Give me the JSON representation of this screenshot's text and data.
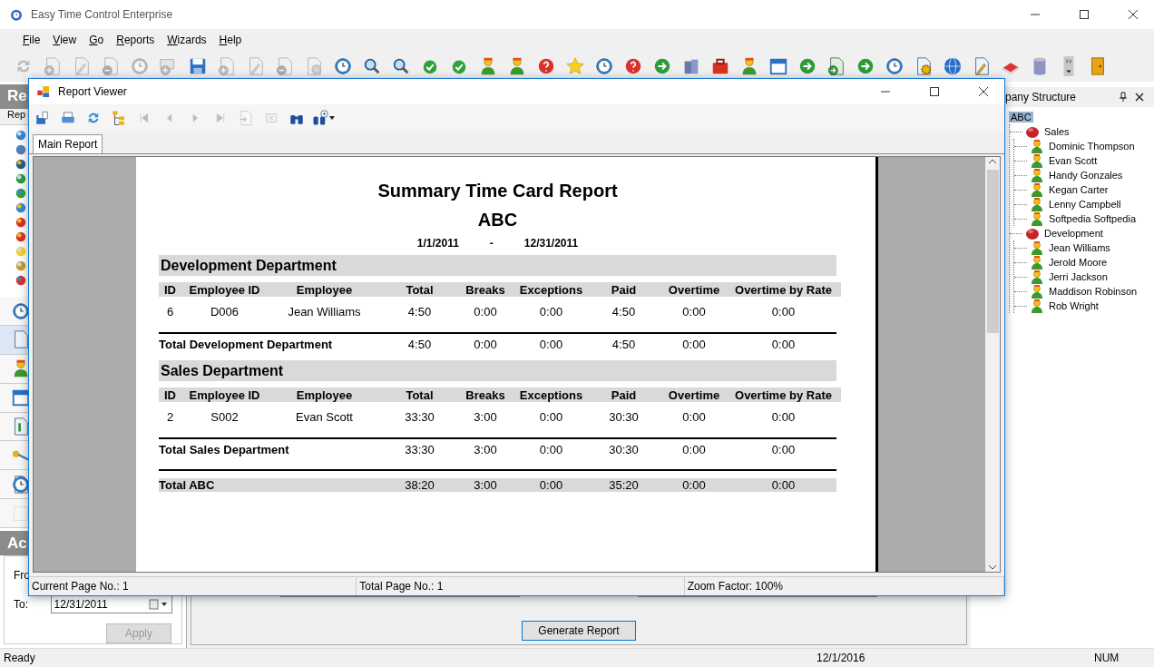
{
  "window": {
    "title": "Easy Time Control Enterprise"
  },
  "menu": [
    "File",
    "View",
    "Go",
    "Reports",
    "Wizards",
    "Help"
  ],
  "toolbar": [
    {
      "kind": "refresh",
      "disabled": true
    },
    {
      "kind": "doc-add",
      "disabled": true
    },
    {
      "kind": "doc-edit",
      "disabled": true
    },
    {
      "kind": "doc-remove",
      "disabled": true
    },
    {
      "kind": "clock",
      "disabled": true
    },
    {
      "kind": "monitor",
      "disabled": true
    },
    {
      "kind": "save",
      "disabled": false
    },
    {
      "kind": "doc-add",
      "disabled": true
    },
    {
      "kind": "doc-edit",
      "disabled": true
    },
    {
      "kind": "doc-remove",
      "disabled": true
    },
    {
      "kind": "doc-gear",
      "disabled": true
    },
    {
      "kind": "clock",
      "disabled": false
    },
    {
      "kind": "search",
      "disabled": false
    },
    {
      "kind": "search",
      "disabled": false
    },
    {
      "kind": "check",
      "disabled": false
    },
    {
      "kind": "check",
      "disabled": false
    },
    {
      "kind": "person",
      "disabled": false
    },
    {
      "kind": "person",
      "disabled": false
    },
    {
      "kind": "help",
      "disabled": false
    },
    {
      "kind": "star",
      "disabled": false
    },
    {
      "kind": "clock",
      "disabled": false
    },
    {
      "kind": "help",
      "disabled": false
    },
    {
      "kind": "arrow",
      "disabled": false
    },
    {
      "kind": "boxes",
      "disabled": false
    },
    {
      "kind": "toolbox",
      "disabled": false
    },
    {
      "kind": "person",
      "disabled": false
    },
    {
      "kind": "calendar",
      "disabled": false
    },
    {
      "kind": "arrow",
      "disabled": false
    },
    {
      "kind": "doc-arrow",
      "disabled": false
    },
    {
      "kind": "arrow",
      "disabled": false
    },
    {
      "kind": "clock",
      "disabled": false
    },
    {
      "kind": "doc-gear",
      "disabled": false
    },
    {
      "kind": "globe",
      "disabled": false
    },
    {
      "kind": "doc-edit",
      "disabled": false
    },
    {
      "kind": "book",
      "disabled": false
    },
    {
      "kind": "database",
      "disabled": false
    },
    {
      "kind": "overflow",
      "disabled": false
    },
    {
      "kind": "door",
      "disabled": false
    }
  ],
  "left_panel": {
    "header": "Re",
    "tab": "Rep",
    "nav": [
      {
        "selected": false
      },
      {
        "selected": true
      },
      {
        "selected": false
      },
      {
        "selected": false
      },
      {
        "selected": false
      },
      {
        "selected": false
      },
      {
        "selected": false
      },
      {
        "selected": false
      }
    ],
    "section_header": "Ac",
    "from_label": "Fro",
    "to_label": "To:",
    "to_value": "12/31/2011",
    "apply_button": {
      "label": "Apply",
      "disabled": true
    }
  },
  "generate_button": "Generate Report",
  "right_panel": {
    "title": "pany Structure",
    "tree": [
      {
        "label": "ABC",
        "kind": "company",
        "selected": true,
        "children": [
          {
            "label": "Sales",
            "kind": "department",
            "selected": false,
            "children": [
              {
                "label": "Dominic Thompson",
                "kind": "employee",
                "selected": false
              },
              {
                "label": "Evan Scott",
                "kind": "employee",
                "selected": false
              },
              {
                "label": "Handy Gonzales",
                "kind": "employee",
                "selected": false
              },
              {
                "label": "Kegan Carter",
                "kind": "employee",
                "selected": false
              },
              {
                "label": "Lenny Campbell",
                "kind": "employee",
                "selected": false
              },
              {
                "label": "Softpedia Softpedia",
                "kind": "employee",
                "selected": false
              }
            ]
          },
          {
            "label": "Development",
            "kind": "department",
            "selected": false,
            "children": [
              {
                "label": "Jean Williams",
                "kind": "employee",
                "selected": false
              },
              {
                "label": "Jerold Moore",
                "kind": "employee",
                "selected": false
              },
              {
                "label": "Jerri Jackson",
                "kind": "employee",
                "selected": false
              },
              {
                "label": "Maddison Robinson",
                "kind": "employee",
                "selected": false
              },
              {
                "label": "Rob Wright",
                "kind": "employee",
                "selected": false
              }
            ]
          }
        ]
      }
    ]
  },
  "status_bar": {
    "message": "Ready",
    "date": "12/1/2016",
    "num": "NUM"
  },
  "report_viewer": {
    "title": "Report Viewer",
    "toolbar": [
      {
        "kind": "save",
        "disabled": false
      },
      {
        "kind": "print",
        "disabled": false
      },
      {
        "kind": "refresh",
        "disabled": false
      },
      {
        "kind": "tree",
        "disabled": false
      },
      {
        "kind": "first",
        "disabled": true
      },
      {
        "kind": "prev",
        "disabled": true
      },
      {
        "kind": "next",
        "disabled": true
      },
      {
        "kind": "last",
        "disabled": true
      },
      {
        "kind": "export",
        "disabled": true
      },
      {
        "kind": "stop",
        "disabled": true
      },
      {
        "kind": "find",
        "disabled": false
      },
      {
        "kind": "zoom",
        "disabled": false
      }
    ],
    "tabs": [
      {
        "label": "Main Report",
        "selected": true
      }
    ],
    "report": {
      "title": "Summary Time Card Report",
      "company": "ABC",
      "date_from": "1/1/2011",
      "date_separator": "-",
      "date_to": "12/31/2011",
      "departments": [
        {
          "name": "Development Department",
          "columns": [
            "ID",
            "Employee ID",
            "Employee",
            "Total",
            "Breaks",
            "Exceptions",
            "Paid",
            "Overtime",
            "Overtime by Rate"
          ],
          "rows": [
            [
              "6",
              "D006",
              "Jean Williams",
              "4:50",
              "0:00",
              "0:00",
              "4:50",
              "0:00",
              "0:00"
            ]
          ],
          "total_label": "Total Development Department",
          "totals": [
            "4:50",
            "0:00",
            "0:00",
            "4:50",
            "0:00",
            "0:00"
          ]
        },
        {
          "name": "Sales Department",
          "columns": [
            "ID",
            "Employee ID",
            "Employee",
            "Total",
            "Breaks",
            "Exceptions",
            "Paid",
            "Overtime",
            "Overtime by Rate"
          ],
          "rows": [
            [
              "2",
              "S002",
              "Evan Scott",
              "33:30",
              "3:00",
              "0:00",
              "30:30",
              "0:00",
              "0:00"
            ]
          ],
          "total_label": "Total Sales Department",
          "totals": [
            "33:30",
            "3:00",
            "0:00",
            "30:30",
            "0:00",
            "0:00"
          ]
        }
      ],
      "grand_total_label": "Total ABC",
      "grand_totals": [
        "38:20",
        "3:00",
        "0:00",
        "35:20",
        "0:00",
        "0:00"
      ]
    },
    "status": [
      "Current Page No.: 1",
      "Total Page No.: 1",
      "Zoom Factor: 100%"
    ]
  }
}
